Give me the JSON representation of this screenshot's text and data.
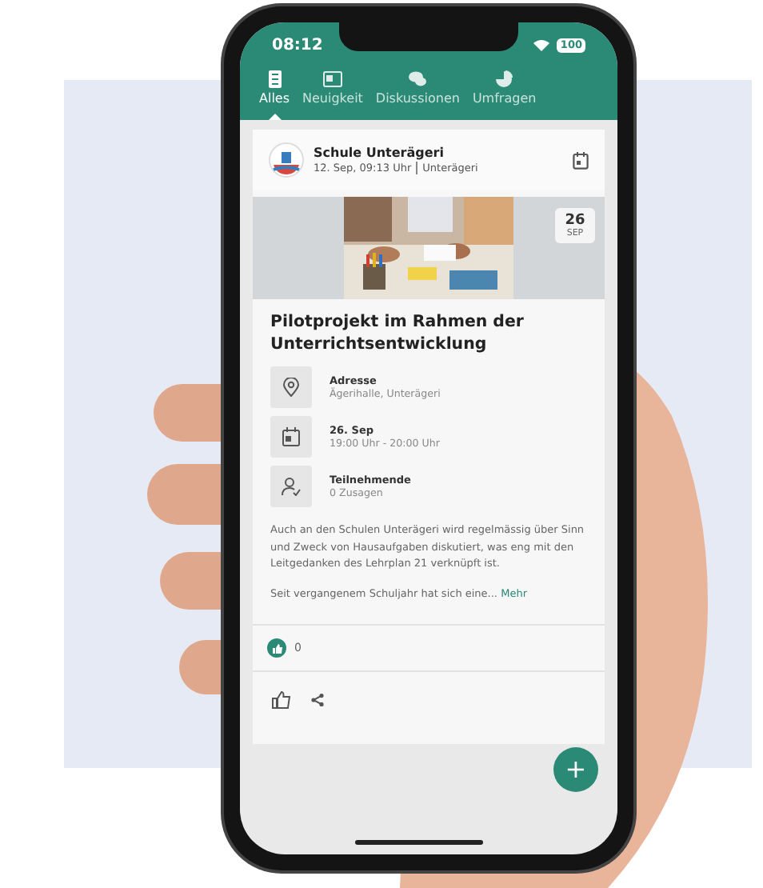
{
  "status_bar": {
    "time": "08:12",
    "battery": "100"
  },
  "tabs": [
    {
      "label": "Alles",
      "selected": true
    },
    {
      "label": "Neuigkeit",
      "selected": false
    },
    {
      "label": "Diskussionen",
      "selected": false
    },
    {
      "label": "Umfragen",
      "selected": false
    }
  ],
  "post": {
    "author": "Schule Unterägeri",
    "date": "12. Sep, 09:13 Uhr",
    "place": "Unterägeri",
    "day": "26",
    "month": "SEP",
    "title": "Pilotprojekt im Rahmen der Unterrichtsentwicklung",
    "details": [
      {
        "label": "Adresse",
        "value": "Ägerihalle, Unterägeri"
      },
      {
        "label": "26. Sep",
        "value": "19:00 Uhr - 20:00 Uhr"
      },
      {
        "label": "Teilnehmende",
        "value": "0 Zusagen"
      }
    ],
    "body": "Auch an den Schulen Unterägeri wird regelmässig über Sinn und Zweck von Hausaufgaben diskutiert, was eng mit den Leitgedanken des Lehrplan 21 verknüpft ist.",
    "teaser": "Seit vergangenem Schuljahr hat sich eine...",
    "more": "Mehr",
    "likes": "0"
  },
  "fab": "+"
}
